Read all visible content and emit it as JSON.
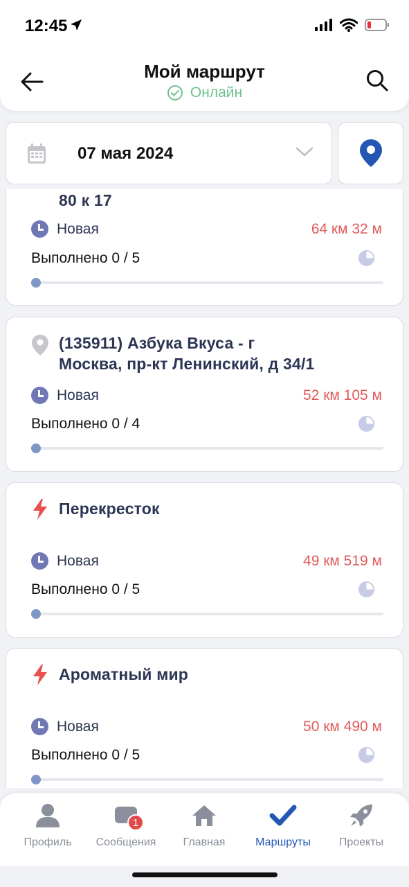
{
  "status_bar": {
    "time": "12:45"
  },
  "header": {
    "title": "Мой маршрут",
    "status": "Онлайн"
  },
  "date_picker": {
    "date": "07 мая 2024"
  },
  "routes": [
    {
      "title_lines": [
        "80 к 17"
      ],
      "icon": "pin-icon",
      "status": "Новая",
      "distance": "64 км 32 м",
      "progress_text": "Выполнено 0 / 5",
      "progress": 0
    },
    {
      "title_lines": [
        "(135911) Азбука Вкуса - г",
        "Москва, пр-кт Ленинский, д 34/1"
      ],
      "icon": "pin-icon",
      "status": "Новая",
      "distance": "52 км 105 м",
      "progress_text": "Выполнено 0 / 4",
      "progress": 0
    },
    {
      "title_lines": [
        "Перекресток"
      ],
      "icon": "lightning-icon",
      "status": "Новая",
      "distance": "49 км 519 м",
      "progress_text": "Выполнено 0 / 5",
      "progress": 0
    },
    {
      "title_lines": [
        "Ароматный мир"
      ],
      "icon": "lightning-icon",
      "status": "Новая",
      "distance": "50 км 490 м",
      "progress_text": "Выполнено 0 / 5",
      "progress": 0
    }
  ],
  "tabs": [
    {
      "label": "Профиль",
      "icon": "profile-icon",
      "active": false
    },
    {
      "label": "Сообщения",
      "icon": "messages-icon",
      "active": false,
      "badge": "1"
    },
    {
      "label": "Главная",
      "icon": "home-icon",
      "active": false
    },
    {
      "label": "Маршруты",
      "icon": "checkmark-icon",
      "active": true
    },
    {
      "label": "Проекты",
      "icon": "rocket-icon",
      "active": false
    }
  ],
  "colors": {
    "accent": "#2456b4",
    "online": "#6fc08d",
    "distance": "#e05a5a",
    "title": "#2c3553",
    "lightning": "#e8504e"
  }
}
